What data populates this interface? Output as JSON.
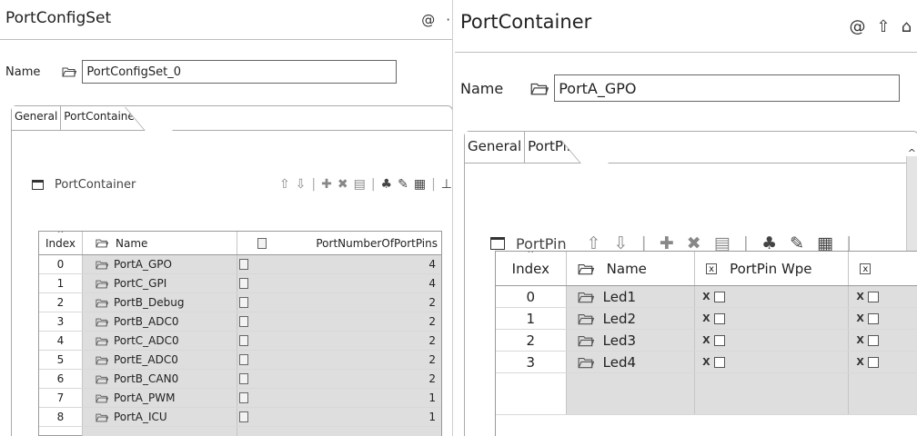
{
  "left": {
    "title": "PortConfigSet",
    "title_icons": [
      "@",
      "·"
    ],
    "name_label": "Name",
    "name_value": "PortConfigSet_0",
    "tabs": [
      "General",
      "PortContainer"
    ],
    "toolbar_title": "PortContainer",
    "columns": [
      "Index",
      "Name",
      "PortNumberOfPortPins"
    ],
    "rows": [
      {
        "index": "0",
        "name": "PortA_GPO",
        "pins": "4"
      },
      {
        "index": "1",
        "name": "PortC_GPI",
        "pins": "4"
      },
      {
        "index": "2",
        "name": "PortB_Debug",
        "pins": "2"
      },
      {
        "index": "3",
        "name": "PortB_ADC0",
        "pins": "2"
      },
      {
        "index": "4",
        "name": "PortC_ADC0",
        "pins": "2"
      },
      {
        "index": "5",
        "name": "PortE_ADC0",
        "pins": "2"
      },
      {
        "index": "6",
        "name": "PortB_CAN0",
        "pins": "2"
      },
      {
        "index": "7",
        "name": "PortA_PWM",
        "pins": "1"
      },
      {
        "index": "8",
        "name": "PortA_ICU",
        "pins": "1"
      }
    ]
  },
  "right": {
    "title": "PortContainer",
    "title_icons": [
      "@",
      "⇧",
      "⌂"
    ],
    "name_label": "Name",
    "name_value": "PortA_GPO",
    "tabs": [
      "General",
      "PortPin"
    ],
    "toolbar_title": "PortPin",
    "columns": [
      "Index",
      "Name",
      "PortPin Wpe"
    ],
    "rows": [
      {
        "index": "0",
        "name": "Led1"
      },
      {
        "index": "1",
        "name": "Led2"
      },
      {
        "index": "2",
        "name": "Led3"
      },
      {
        "index": "3",
        "name": "Led4"
      }
    ]
  },
  "icons": {
    "up": "⇧",
    "down": "⇩",
    "add": "✚",
    "delete": "✖",
    "copy": "▤",
    "wizard": "♣",
    "edit": "✎",
    "report": "▦",
    "export": "⊥"
  },
  "colors": {
    "grid_gray": "#dedede",
    "border": "#999999"
  }
}
